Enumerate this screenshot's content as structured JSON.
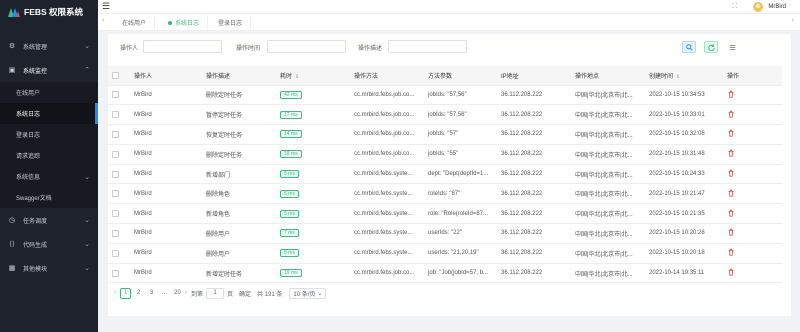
{
  "app": {
    "title": "FEBS 权限系统"
  },
  "sidebar": {
    "groups": [
      {
        "label": "系统管理",
        "icon": "gear-icon",
        "open": false
      },
      {
        "label": "系统监控",
        "icon": "monitor-icon",
        "open": true,
        "items": [
          {
            "label": "在线用户",
            "active": false
          },
          {
            "label": "系统日志",
            "active": true
          },
          {
            "label": "登录日志",
            "active": false
          },
          {
            "label": "请求追踪",
            "active": false
          },
          {
            "label": "系统信息",
            "active": false,
            "has_children": true
          },
          {
            "label": "Swagger文档",
            "active": false
          }
        ]
      },
      {
        "label": "任务调度",
        "icon": "clock-icon",
        "open": false
      },
      {
        "label": "代码生成",
        "icon": "code-icon",
        "open": false
      },
      {
        "label": "其他模块",
        "icon": "grid-icon",
        "open": false
      }
    ]
  },
  "header": {
    "user": "MrBird"
  },
  "tabs": [
    {
      "label": "在线用户",
      "active": false
    },
    {
      "label": "系统日志",
      "active": true
    },
    {
      "label": "登录日志",
      "active": false
    }
  ],
  "search": {
    "operator_label": "操作人",
    "time_label": "操作时间",
    "desc_label": "操作描述"
  },
  "table": {
    "headers": [
      "操作人",
      "操作描述",
      "耗时",
      "操作方法",
      "方法参数",
      "IP地址",
      "操作地点",
      "创建时间",
      "操作"
    ],
    "rows": [
      {
        "user": "MrBird",
        "desc": "删除定时任务",
        "time": "42 ms",
        "method": "cc.mrbird.febs.job.co...",
        "params": "jobIds: \"57,56\"",
        "ip": "36.112.208.222",
        "loc": "中国|华北|北京市|北...",
        "created": "2022-10-15 10:34:53"
      },
      {
        "user": "MrBird",
        "desc": "暂停定时任务",
        "time": "17 ms",
        "method": "cc.mrbird.febs.job.co...",
        "params": "jobIds: \"57,56\"",
        "ip": "36.112.208.222",
        "loc": "中国|华北|北京市|北...",
        "created": "2022-10-15 10:33:01"
      },
      {
        "user": "MrBird",
        "desc": "恢复定时任务",
        "time": "14 ms",
        "method": "cc.mrbird.febs.job.co...",
        "params": "jobIds: \"57\"",
        "ip": "36.112.208.222",
        "loc": "中国|华北|北京市|北...",
        "created": "2022-10-15 10:32:08"
      },
      {
        "user": "MrBird",
        "desc": "删除定时任务",
        "time": "18 ms",
        "method": "cc.mrbird.febs.job.co...",
        "params": "jobIds: \"55\"",
        "ip": "36.112.208.222",
        "loc": "中国|华北|北京市|北...",
        "created": "2022-10-15 10:31:48"
      },
      {
        "user": "MrBird",
        "desc": "新增部门",
        "time": "5 ms",
        "method": "cc.mrbird.febs.syste...",
        "params": "dept: \"Dept(deptId=1...",
        "ip": "36.112.208.222",
        "loc": "中国|华北|北京市|北...",
        "created": "2022-10-15 10:24:33"
      },
      {
        "user": "MrBird",
        "desc": "删除角色",
        "time": "6 ms",
        "method": "cc.mrbird.febs.syste...",
        "params": "roleIds: \"87\"",
        "ip": "36.112.208.222",
        "loc": "中国|华北|北京市|北...",
        "created": "2022-10-15 10:21:47"
      },
      {
        "user": "MrBird",
        "desc": "新增角色",
        "time": "5 ms",
        "method": "cc.mrbird.febs.syste...",
        "params": "role: \"Role(roleId=87...",
        "ip": "36.112.208.222",
        "loc": "中国|华北|北京市|北...",
        "created": "2022-10-15 10:21:35"
      },
      {
        "user": "MrBird",
        "desc": "删除用户",
        "time": "7 ms",
        "method": "cc.mrbird.febs.syste...",
        "params": "userIds: \"22\"",
        "ip": "36.112.208.222",
        "loc": "中国|华北|北京市|北...",
        "created": "2022-10-15 10:20:28"
      },
      {
        "user": "MrBird",
        "desc": "删除用户",
        "time": "8 ms",
        "method": "cc.mrbird.febs.syste...",
        "params": "userIds: \"21,20,19\"",
        "ip": "36.112.208.222",
        "loc": "中国|华北|北京市|北...",
        "created": "2022-10-15 10:20:18"
      },
      {
        "user": "MrBird",
        "desc": "新增定时任务",
        "time": "19 ms",
        "method": "cc.mrbird.febs.job.co...",
        "params": "job: \"Job(jobId=57, b...",
        "ip": "36.112.208.222",
        "loc": "中国|华北|北京市|北...",
        "created": "2022-10-14 19:35:11"
      }
    ]
  },
  "pager": {
    "pages": [
      "1",
      "2",
      "3",
      "...",
      "20"
    ],
    "goto_label": "到第",
    "goto_value": "1",
    "page_unit": "页",
    "confirm": "确定",
    "total": "共 191 条",
    "page_size": "10 条/页"
  },
  "colors": {
    "sidebar": "#1e222d",
    "accent": "#42b983",
    "danger": "#e34b4b"
  }
}
